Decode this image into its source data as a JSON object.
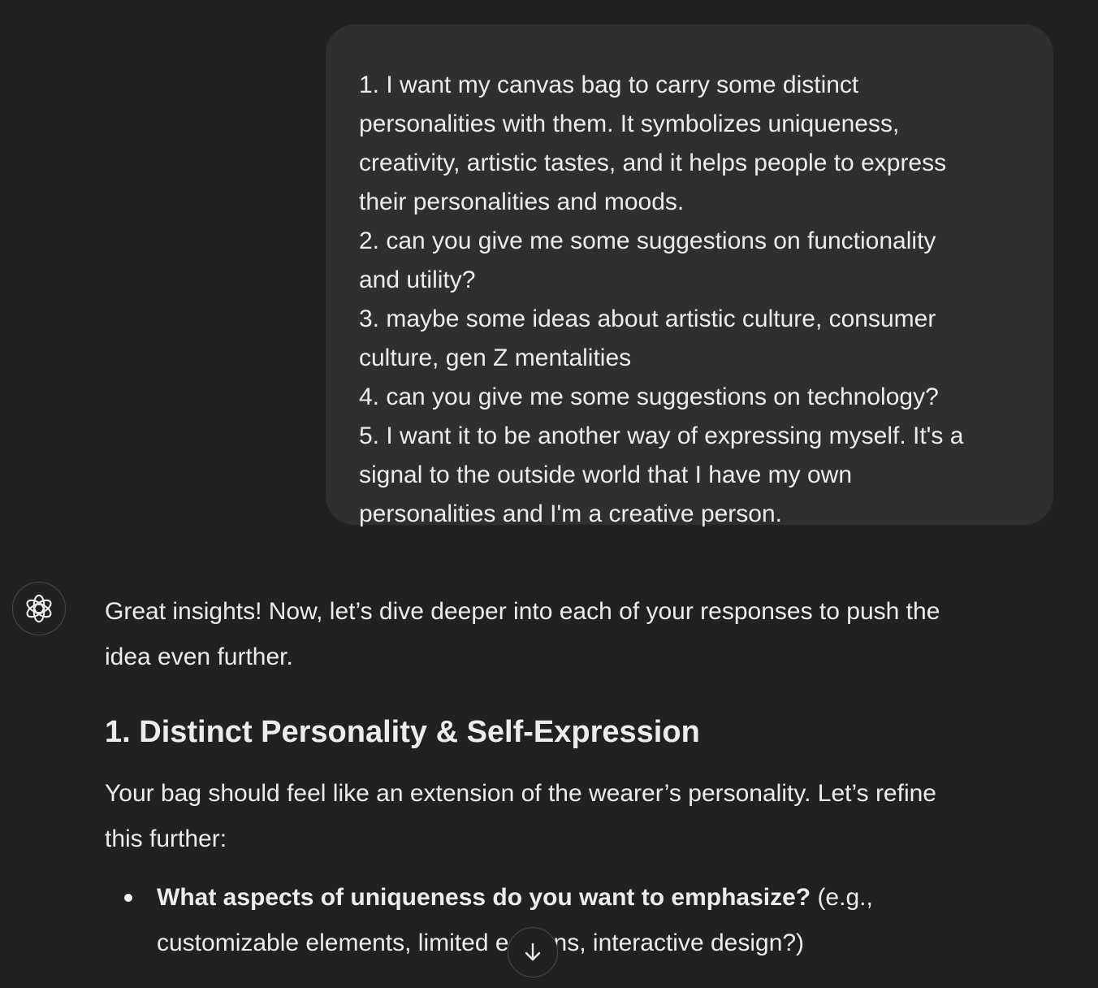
{
  "user_message": {
    "lines": [
      "1. I want my canvas bag to carry some distinct",
      "personalities with them. It symbolizes uniqueness,",
      "creativity, artistic tastes, and it helps people to express",
      "their personalities and moods.",
      "2. can you give me some suggestions on functionality",
      "and utility?",
      "3. maybe some ideas about artistic culture, consumer",
      "culture, gen Z mentalities",
      "4. can you give me some suggestions on technology?",
      "5. I want it to be another way of expressing myself. It's a",
      "signal to the outside world that I have my own",
      "personalities and I'm a creative person."
    ]
  },
  "assistant": {
    "avatar_icon": "openai-logo-icon",
    "intro_lines": [
      "Great insights! Now, let’s dive deeper into each of your responses to push the",
      "idea even further."
    ],
    "heading": "1. Distinct Personality & Self-Expression",
    "para_lines": [
      "Your bag should feel like an extension of the wearer’s personality. Let’s refine",
      "this further:"
    ],
    "bullet": {
      "bold": "What aspects of uniqueness do you want to emphasize?",
      "rest_line1": " (e.g.,",
      "line2": "customizable elements, limited editions, interactive design?)"
    }
  },
  "scroll_button": {
    "icon": "arrow-down-icon"
  },
  "colors": {
    "background": "#212121",
    "user_bubble": "#2f2f2f",
    "text": "#ececec",
    "border": "#4a4a4a"
  }
}
